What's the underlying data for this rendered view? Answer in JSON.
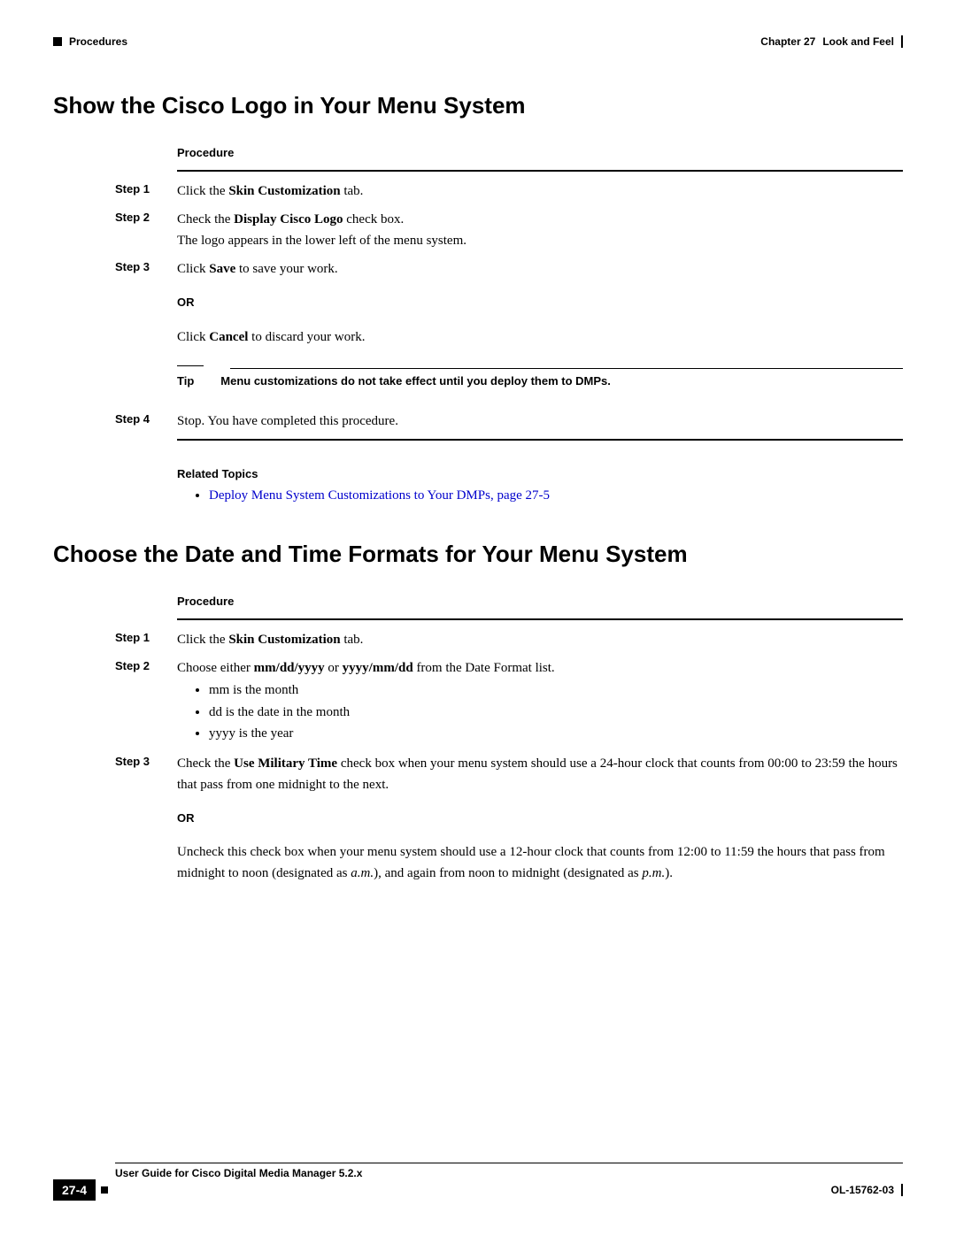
{
  "header": {
    "left_label": "Procedures",
    "chapter": "Chapter 27",
    "chapter_title": "Look and Feel"
  },
  "section1": {
    "title": "Show the Cisco Logo in Your Menu System",
    "procedure_label": "Procedure",
    "steps": {
      "s1_label": "Step 1",
      "s1_a": "Click the ",
      "s1_b": "Skin Customization",
      "s1_c": " tab.",
      "s2_label": "Step 2",
      "s2_a": "Check the ",
      "s2_b": "Display Cisco Logo",
      "s2_c": " check box.",
      "s2_note": "The logo appears in the lower left of the menu system.",
      "s3_label": "Step 3",
      "s3_a": "Click ",
      "s3_b": "Save",
      "s3_c": " to save your work.",
      "or": "OR",
      "s3_alt_a": "Click ",
      "s3_alt_b": "Cancel",
      "s3_alt_c": " to discard your work.",
      "tip_label": "Tip",
      "tip_text": "Menu customizations do not take effect until you deploy them to DMPs.",
      "s4_label": "Step 4",
      "s4_text": "Stop. You have completed this procedure."
    },
    "related_label": "Related Topics",
    "related_link": "Deploy Menu System Customizations to Your DMPs, page 27-5"
  },
  "section2": {
    "title": "Choose the Date and Time Formats for Your Menu System",
    "procedure_label": "Procedure",
    "steps": {
      "s1_label": "Step 1",
      "s1_a": "Click the ",
      "s1_b": "Skin Customization",
      "s1_c": " tab.",
      "s2_label": "Step 2",
      "s2_a": "Choose either ",
      "s2_b": "mm/dd/yyyy",
      "s2_c": " or ",
      "s2_d": "yyyy/mm/dd",
      "s2_e": " from the Date Format list.",
      "s2_bullets": {
        "b1": "mm is the month",
        "b2": "dd is the date in the month",
        "b3": "yyyy is the year"
      },
      "s3_label": "Step 3",
      "s3_a": "Check the ",
      "s3_b": "Use Military Time",
      "s3_c": " check box when your menu system should use a 24-hour clock that counts from 00:00 to 23:59 the hours that pass from one midnight to the next.",
      "or": "OR",
      "s3_alt_a": "Uncheck this check box when your menu system should use a 12-hour clock that counts from 12:00 to 11:59 the hours that pass from midnight to noon (designated as ",
      "s3_alt_b": "a.m.",
      "s3_alt_c": "), and again from noon to midnight (designated as ",
      "s3_alt_d": "p.m.",
      "s3_alt_e": ")."
    }
  },
  "footer": {
    "guide": "User Guide for Cisco Digital Media Manager 5.2.x",
    "page": "27-4",
    "doc_id": "OL-15762-03"
  }
}
